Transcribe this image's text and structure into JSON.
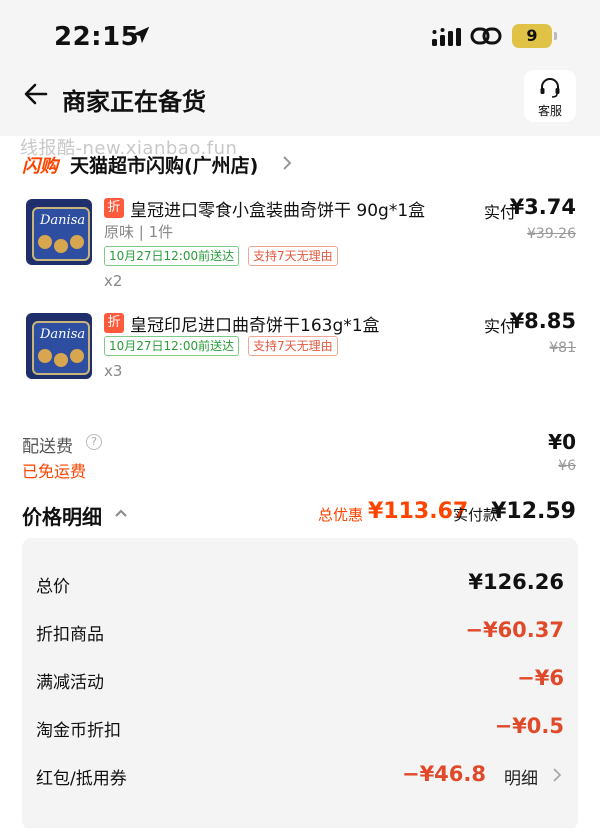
{
  "status_bar": {
    "time": "22:15",
    "battery": "9",
    "icons": [
      "location-arrow-icon",
      "signal-icon",
      "link-icon",
      "battery-icon"
    ]
  },
  "header": {
    "title": "商家正在备货",
    "service_label": "客服"
  },
  "watermark": "线报酷-new.xianbao.fun",
  "store": {
    "logo_text": "闪购",
    "name": "天猫超市闪购(广州店)"
  },
  "items": [
    {
      "tag": "折",
      "name": "皇冠进口零食小盒装曲奇饼干 90g*1盒",
      "variant": "原味 | 1件",
      "delivery": "10月27日12:00前送达",
      "return_policy": "支持7天无理由",
      "qty": "x2",
      "pay_label": "实付",
      "pay_value": "¥3.74",
      "original_price": "¥39.26"
    },
    {
      "tag": "折",
      "name": "皇冠印尼进口曲奇饼干163g*1盒",
      "delivery": "10月27日12:00前送达",
      "return_policy": "支持7天无理由",
      "qty": "x3",
      "pay_label": "实付",
      "pay_value": "¥8.85",
      "original_price": "¥81"
    }
  ],
  "shipping": {
    "label": "配送费",
    "value": "¥0",
    "free_text": "已免运费",
    "original": "¥6"
  },
  "price_summary": {
    "title": "价格明细",
    "discount_label": "总优惠",
    "discount_value": "¥113.67",
    "total_label": "实付款",
    "total_value": "¥12.59"
  },
  "details": [
    {
      "label": "总价",
      "value": "¥126.26"
    },
    {
      "label": "折扣商品",
      "value": "−¥60.37"
    },
    {
      "label": "满减活动",
      "value": "−¥6"
    },
    {
      "label": "淘金币折扣",
      "value": "−¥0.5"
    },
    {
      "label": "红包/抵用券",
      "value": "−¥46.8",
      "link": "明细"
    }
  ],
  "colors": {
    "accent": "#ff4400",
    "discount_red": "#e04a2a",
    "header_bg": "#f5f5f5",
    "panel_bg": "#f4f4f4"
  }
}
